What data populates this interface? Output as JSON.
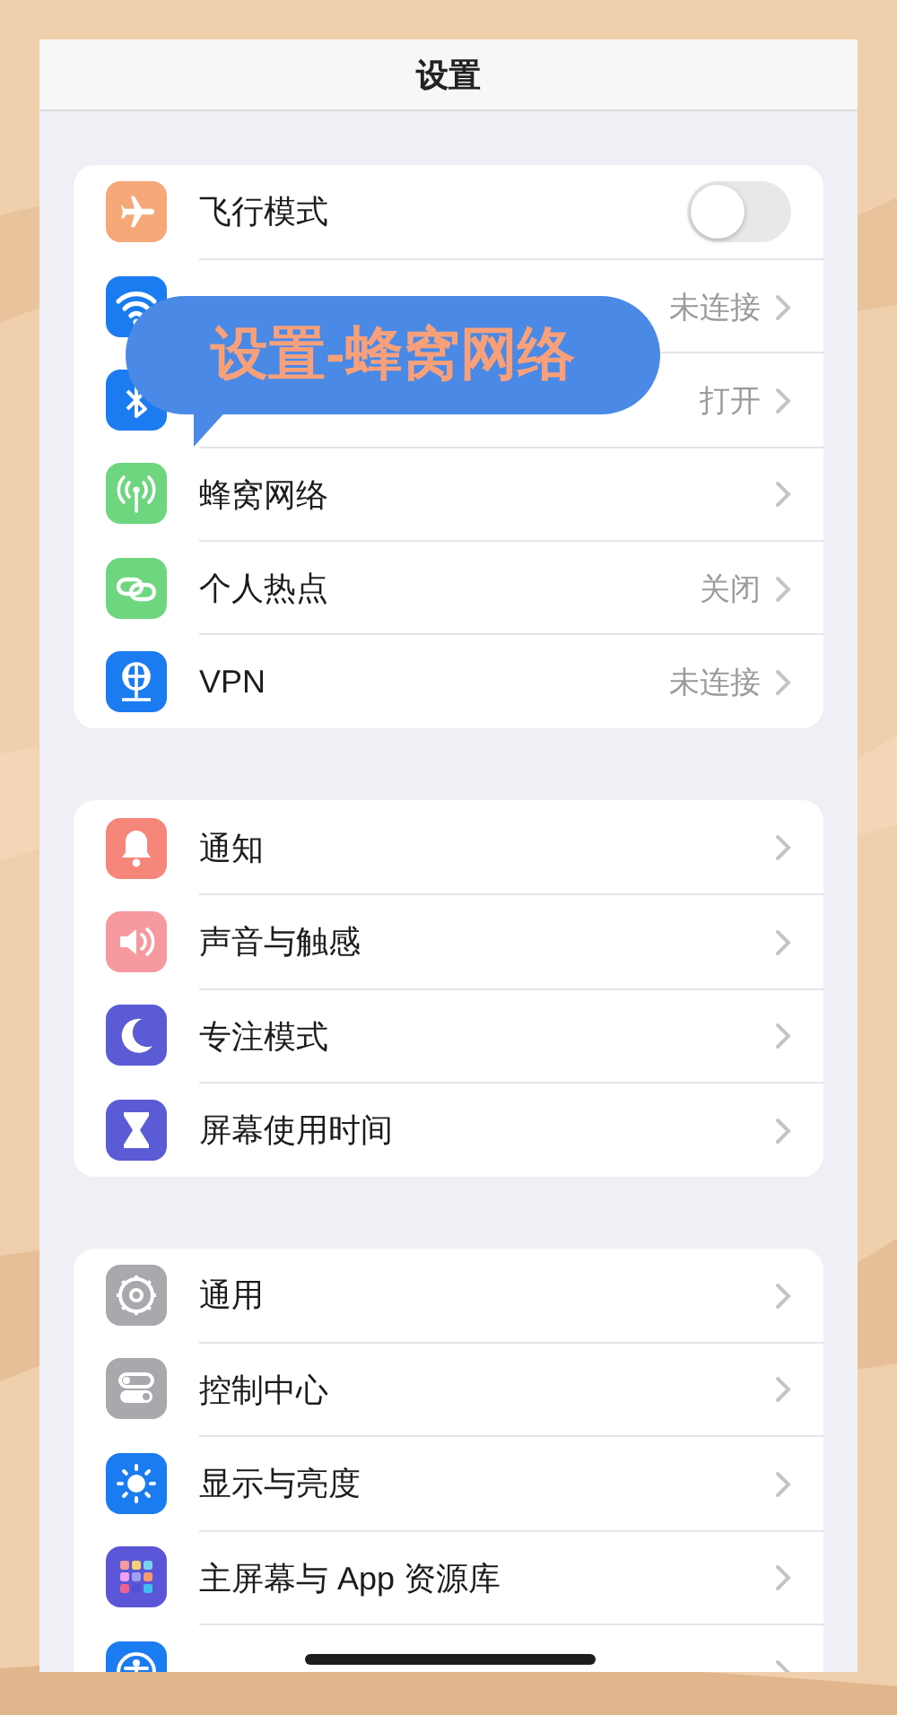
{
  "navigation_bar": {
    "title": "设置"
  },
  "callout": {
    "text": "设置-蜂窝网络"
  },
  "groups": [
    {
      "rows": [
        {
          "kind": "toggle",
          "color": "#f7a878",
          "label": "飞行模式",
          "on": false
        },
        {
          "kind": "link",
          "color": "#1a7cf0",
          "value": "未连接"
        },
        {
          "kind": "link",
          "color": "#1a7cf0",
          "value": "打开"
        },
        {
          "kind": "link",
          "color": "#6fd680",
          "label": "蜂窝网络"
        },
        {
          "kind": "link",
          "color": "#6fd680",
          "label": "个人热点",
          "value": "关闭"
        },
        {
          "kind": "link",
          "color": "#1a7cf0",
          "label": "VPN",
          "value": "未连接"
        }
      ]
    },
    {
      "rows": [
        {
          "kind": "link",
          "color": "#f7867a",
          "label": "通知"
        },
        {
          "kind": "link",
          "color": "#f79aa0",
          "label": "声音与触感"
        },
        {
          "kind": "link",
          "color": "#5b5bd6",
          "label": "专注模式"
        },
        {
          "kind": "link",
          "color": "#5b5bd6",
          "label": "屏幕使用时间"
        }
      ]
    },
    {
      "rows": [
        {
          "kind": "link",
          "color": "#a8a8ad",
          "label": "通用"
        },
        {
          "kind": "link",
          "color": "#a8a8ad",
          "label": "控制中心"
        },
        {
          "kind": "link",
          "color": "#1a7cf0",
          "label": "显示与亮度"
        },
        {
          "kind": "link",
          "color": "#5b55d8",
          "label": "主屏幕与 App 资源库"
        },
        {
          "kind": "link",
          "color": "#1a7cf0"
        }
      ]
    }
  ]
}
